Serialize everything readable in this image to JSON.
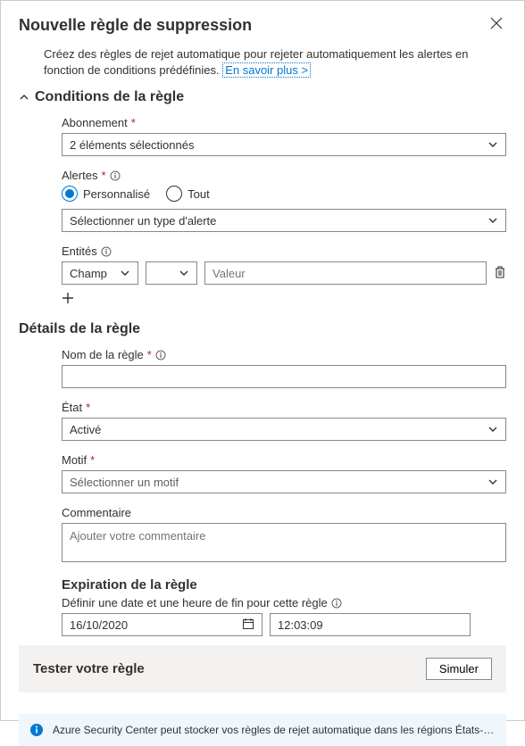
{
  "header": {
    "title": "Nouvelle règle de suppression"
  },
  "description": {
    "text": "Créez des règles de rejet automatique pour rejeter automatiquement les alertes en fonction de conditions prédéfinies.",
    "link": "En savoir plus >"
  },
  "conditions": {
    "section_title": "Conditions de la règle",
    "subscription": {
      "label": "Abonnement",
      "value": "2 éléments sélectionnés"
    },
    "alerts": {
      "label": "Alertes",
      "options": {
        "custom": "Personnalisé",
        "all": "Tout"
      },
      "selected": "custom",
      "type_placeholder": "Sélectionner un type d'alerte"
    },
    "entities": {
      "label": "Entités",
      "field_value": "Champ",
      "value_placeholder": "Valeur"
    }
  },
  "details": {
    "section_title": "Détails de la règle",
    "name": {
      "label": "Nom de la règle",
      "value": ""
    },
    "state": {
      "label": "État",
      "value": "Activé"
    },
    "reason": {
      "label": "Motif",
      "placeholder": "Sélectionner un motif"
    },
    "comment": {
      "label": "Commentaire",
      "placeholder": "Ajouter votre commentaire"
    }
  },
  "expiration": {
    "section_title": "Expiration de la règle",
    "subtitle": "Définir une date et une heure de fin pour cette règle",
    "date": "16/10/2020",
    "time": "12:03:09"
  },
  "test": {
    "title": "Tester votre règle",
    "button": "Simuler"
  },
  "notice": {
    "text": "Azure Security Center peut stocker vos règles de rejet automatique dans les régions États-Unis…"
  }
}
